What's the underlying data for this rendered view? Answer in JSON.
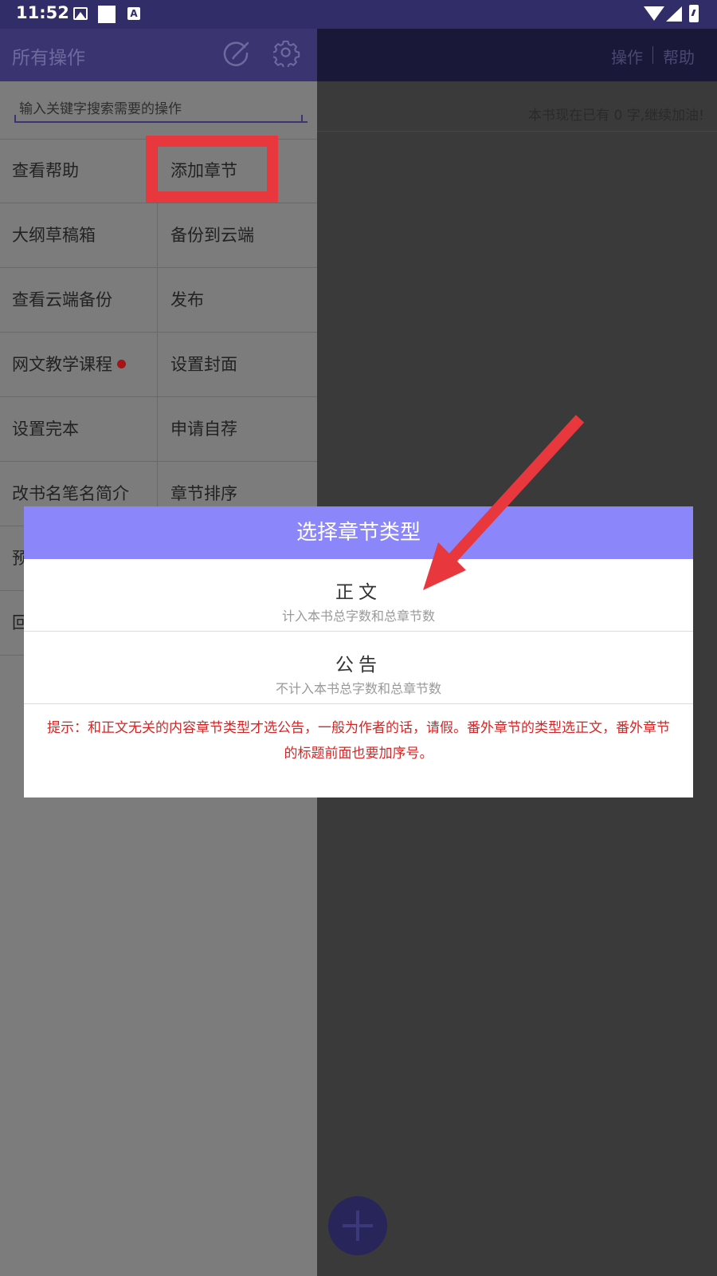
{
  "status_bar": {
    "time": "11:52",
    "icons": [
      "image-icon",
      "square-icon",
      "a-badge-icon",
      "wifi-icon",
      "signal-icon",
      "battery-icon"
    ]
  },
  "drawer": {
    "title": "所有操作",
    "search_placeholder": "输入关键字搜索需要的操作",
    "rows": [
      [
        "查看帮助",
        "添加章节"
      ],
      [
        "大纲草稿箱",
        "备份到云端"
      ],
      [
        "查看云端备份",
        "发布"
      ],
      [
        "网文教学课程",
        "设置封面"
      ],
      [
        "设置完本",
        "申请自荐"
      ],
      [
        "改书名笔名简介",
        "章节排序"
      ],
      [
        "预",
        ""
      ],
      [
        "回",
        ""
      ]
    ]
  },
  "main": {
    "actions": [
      "操作",
      "帮助"
    ],
    "word_count": "本书现在已有 0 字,继续加油!"
  },
  "dialog": {
    "title": "选择章节类型",
    "options": [
      {
        "title": "正文",
        "subtitle": "计入本书总字数和总章节数"
      },
      {
        "title": "公告",
        "subtitle": "不计入本书总字数和总章节数"
      }
    ],
    "tip": "提示：和正文无关的内容章节类型才选公告，一般为作者的话，请假。番外章节的类型选正文，番外章节的标题前面也要加序号。"
  },
  "colors": {
    "status_bar": "#312d68",
    "dialog_header": "#8b87fb",
    "tip_text": "#d42626",
    "highlight": "#e8383d"
  }
}
